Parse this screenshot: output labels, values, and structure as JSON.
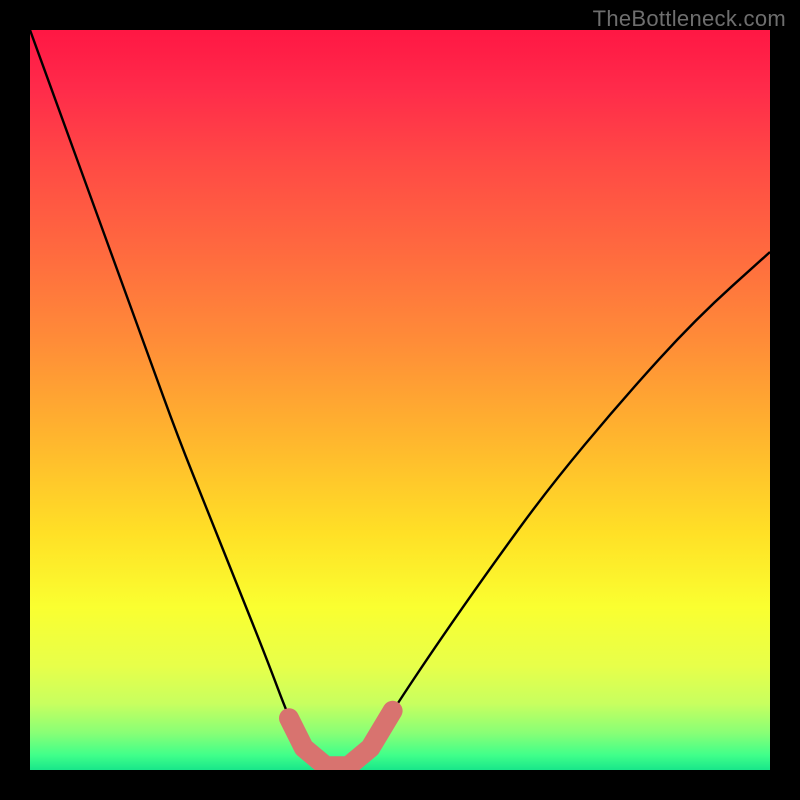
{
  "watermark": "TheBottleneck.com",
  "chart_data": {
    "type": "line",
    "title": "",
    "xlabel": "",
    "ylabel": "",
    "xlim": [
      0,
      100
    ],
    "ylim": [
      0,
      100
    ],
    "series": [
      {
        "name": "bottleneck-curve",
        "x": [
          0,
          4,
          8,
          12,
          16,
          20,
          24,
          28,
          32,
          35,
          37,
          40,
          43,
          46,
          49,
          55,
          62,
          70,
          80,
          90,
          100
        ],
        "y": [
          100,
          89,
          78,
          67,
          56,
          45,
          35,
          25,
          15,
          7,
          3,
          0.5,
          0.5,
          3,
          8,
          17,
          27,
          38,
          50,
          61,
          70
        ]
      }
    ],
    "highlight": {
      "name": "low-bottleneck-zone",
      "x": [
        35,
        37,
        40,
        43,
        46,
        49
      ],
      "y": [
        7,
        3,
        0.5,
        0.5,
        3,
        8
      ],
      "color": "#d8736f"
    },
    "background_gradient": {
      "stops": [
        {
          "offset": 0.0,
          "color": "#ff1744"
        },
        {
          "offset": 0.08,
          "color": "#ff2b4a"
        },
        {
          "offset": 0.18,
          "color": "#ff4a45"
        },
        {
          "offset": 0.3,
          "color": "#ff6a3f"
        },
        {
          "offset": 0.42,
          "color": "#ff8c38"
        },
        {
          "offset": 0.55,
          "color": "#ffb52e"
        },
        {
          "offset": 0.68,
          "color": "#ffe026"
        },
        {
          "offset": 0.78,
          "color": "#faff30"
        },
        {
          "offset": 0.86,
          "color": "#e7ff4a"
        },
        {
          "offset": 0.91,
          "color": "#c8ff5f"
        },
        {
          "offset": 0.95,
          "color": "#88ff76"
        },
        {
          "offset": 0.98,
          "color": "#40ff8a"
        },
        {
          "offset": 1.0,
          "color": "#18e68a"
        }
      ]
    }
  }
}
